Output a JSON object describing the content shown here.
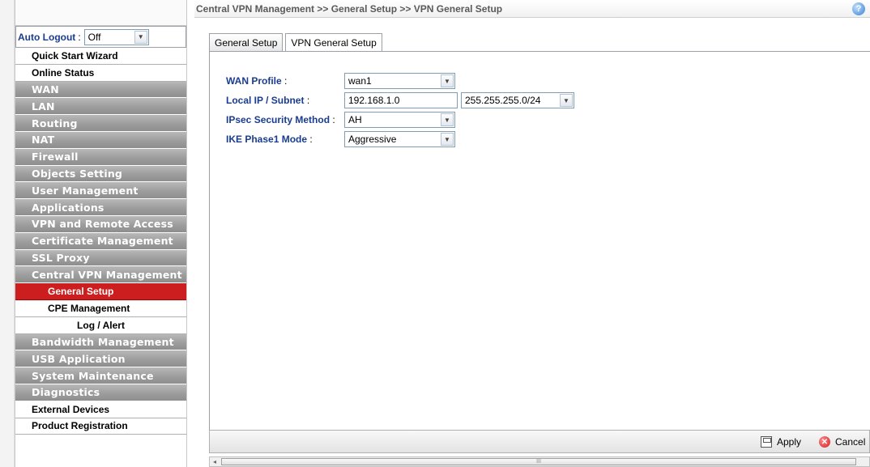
{
  "breadcrumb": "Central VPN Management >> General Setup >> VPN General Setup",
  "help_icon": "?",
  "sidebar": {
    "auto_logout_label": "Auto Logout",
    "auto_logout_sep": ":",
    "auto_logout_value": "Off",
    "items": [
      {
        "label": "Quick Start Wizard",
        "style": "white"
      },
      {
        "label": "Online Status",
        "style": "white"
      },
      {
        "label": "WAN",
        "style": "gray"
      },
      {
        "label": "LAN",
        "style": "gray"
      },
      {
        "label": "Routing",
        "style": "gray"
      },
      {
        "label": "NAT",
        "style": "gray"
      },
      {
        "label": "Firewall",
        "style": "gray"
      },
      {
        "label": "Objects Setting",
        "style": "gray"
      },
      {
        "label": "User Management",
        "style": "gray"
      },
      {
        "label": "Applications",
        "style": "gray"
      },
      {
        "label": "VPN and Remote Access",
        "style": "gray"
      },
      {
        "label": "Certificate Management",
        "style": "gray"
      },
      {
        "label": "SSL Proxy",
        "style": "gray"
      },
      {
        "label": "Central VPN Management",
        "style": "gray"
      },
      {
        "label": "General Setup",
        "style": "active"
      },
      {
        "label": "CPE Management",
        "style": "sub"
      },
      {
        "label": "Log / Alert",
        "style": "sub"
      },
      {
        "label": "Bandwidth Management",
        "style": "gray"
      },
      {
        "label": "USB Application",
        "style": "gray"
      },
      {
        "label": "System Maintenance",
        "style": "gray"
      },
      {
        "label": "Diagnostics",
        "style": "gray"
      },
      {
        "label": "External Devices",
        "style": "white"
      },
      {
        "label": "Product Registration",
        "style": "white"
      }
    ]
  },
  "tabs": [
    {
      "label": "General Setup",
      "active": false
    },
    {
      "label": "VPN General Setup",
      "active": true
    }
  ],
  "form": {
    "wan_profile_label": "WAN Profile",
    "wan_profile_value": "wan1",
    "local_ip_label": "Local IP / Subnet",
    "local_ip_value": "192.168.1.0",
    "subnet_value": "255.255.255.0/24",
    "ipsec_label": "IPsec Security Method",
    "ipsec_value": "AH",
    "ike_label": "IKE Phase1 Mode",
    "ike_value": "Aggressive",
    "colon": ":"
  },
  "actions": {
    "apply_label": "Apply",
    "cancel_label": "Cancel"
  },
  "scrollbar": {
    "left_arrow": "◂",
    "grip": "III"
  },
  "colors": {
    "active_menu": "#cc1e1e",
    "label_blue": "#1a3c8f"
  }
}
